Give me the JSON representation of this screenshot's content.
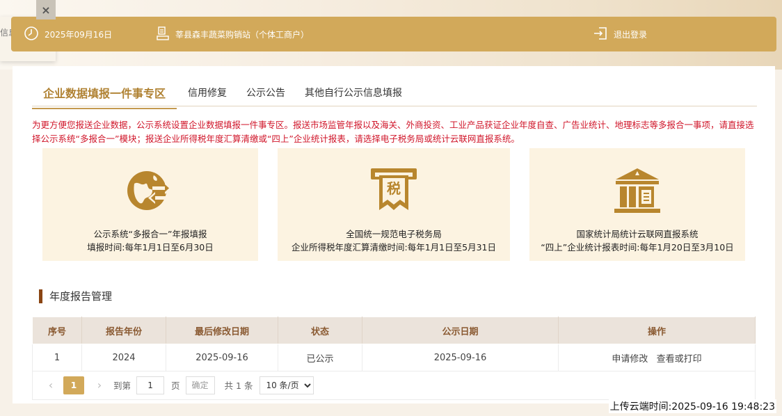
{
  "side_tab": {
    "text": "信息"
  },
  "close_button": {
    "label": "×"
  },
  "header": {
    "date": "2025年09月16日",
    "company": "莘县森丰蔬菜购销站（个体工商户）",
    "logout": "退出登录"
  },
  "tabs": [
    {
      "label": "企业数据填报一件事专区",
      "active": true
    },
    {
      "label": "信用修复",
      "active": false
    },
    {
      "label": "公示公告",
      "active": false
    },
    {
      "label": "其他自行公示信息填报",
      "active": false
    }
  ],
  "notice": "为更方便您报送企业数据，公示系统设置企业数据填报一件事专区。报送市场监管年报以及海关、外商投资、工业产品获证企业年度自查、广告业统计、地理标志等多报合一事项，请直接选择公示系统“多报合一”模块；报送企业所得税年度汇算清缴或“四上”企业统计报表，请选择电子税务局或统计云联网直报系统。",
  "cards": [
    {
      "icon": "globe-exchange-icon",
      "title": "公示系统“多报合一”年报填报",
      "subtitle": "填报时间:每年1月1日至6月30日"
    },
    {
      "icon": "tax-ticket-icon",
      "icon_text": "税",
      "title": "全国统一规范电子税务局",
      "subtitle": "企业所得税年度汇算清缴时间:每年1月1日至5月31日"
    },
    {
      "icon": "government-building-icon",
      "title": "国家统计局统计云联网直报系统",
      "subtitle": "“四上”企业统计报表时间:每年1月20日至3月10日"
    }
  ],
  "section": {
    "title": "年度报告管理"
  },
  "table": {
    "headers": [
      "序号",
      "报告年份",
      "最后修改日期",
      "状态",
      "公示日期",
      "操作"
    ],
    "rows": [
      {
        "index": "1",
        "year": "2024",
        "modified": "2025-09-16",
        "status": "已公示",
        "published": "2025-09-16",
        "action1": "申请修改",
        "action2": "查看或打印"
      }
    ]
  },
  "pager": {
    "current_page": "1",
    "goto_label": "到第",
    "goto_value": "1",
    "page_label": "页",
    "confirm_label": "确定",
    "total": "共 1 条",
    "page_size": "10 条/页"
  },
  "footer": {
    "upload_time": "上传云端时间:2025-09-16 19:48:23"
  },
  "colors": {
    "accent": "#d2a95a",
    "icon_gold": "#b8862e",
    "notice_red": "#d0162a",
    "section_bar": "#8a4513",
    "card_bg": "#fcf3e1"
  }
}
